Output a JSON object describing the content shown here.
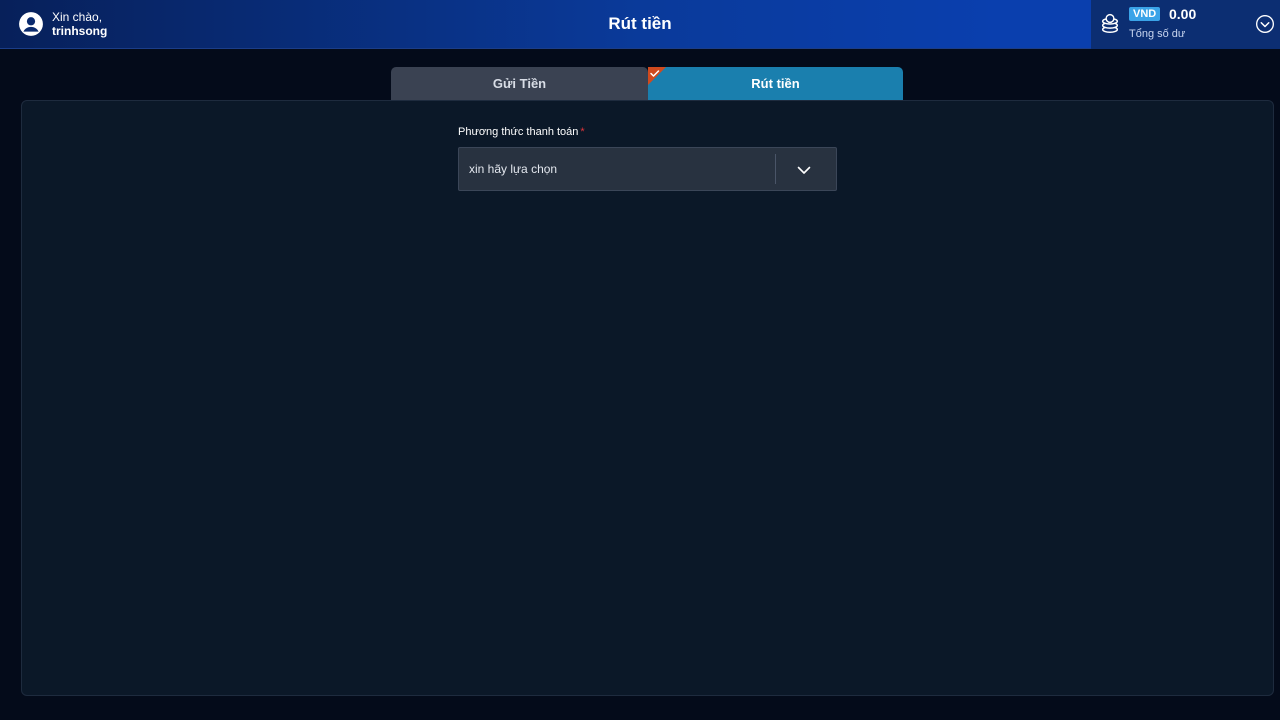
{
  "header": {
    "greeting": "Xin chào,",
    "username": "trinhsong",
    "title": "Rút tiền"
  },
  "balance": {
    "currency": "VND",
    "amount": "0.00",
    "label": "Tổng số dư",
    "icon": "coins-icon"
  },
  "tabs": [
    {
      "label": "Gửi Tiền",
      "active": false
    },
    {
      "label": "Rút tiền",
      "active": true
    }
  ],
  "form": {
    "payment_method_label": "Phương thức thanh toán",
    "required_mark": "*",
    "payment_method_placeholder": "xin hãy lựa chọn"
  },
  "colors": {
    "accent": "#1a7fae",
    "header": "#0a3fae",
    "badge": "#3aa3e8",
    "check_corner": "#d04a1e",
    "required": "#e0343a"
  }
}
